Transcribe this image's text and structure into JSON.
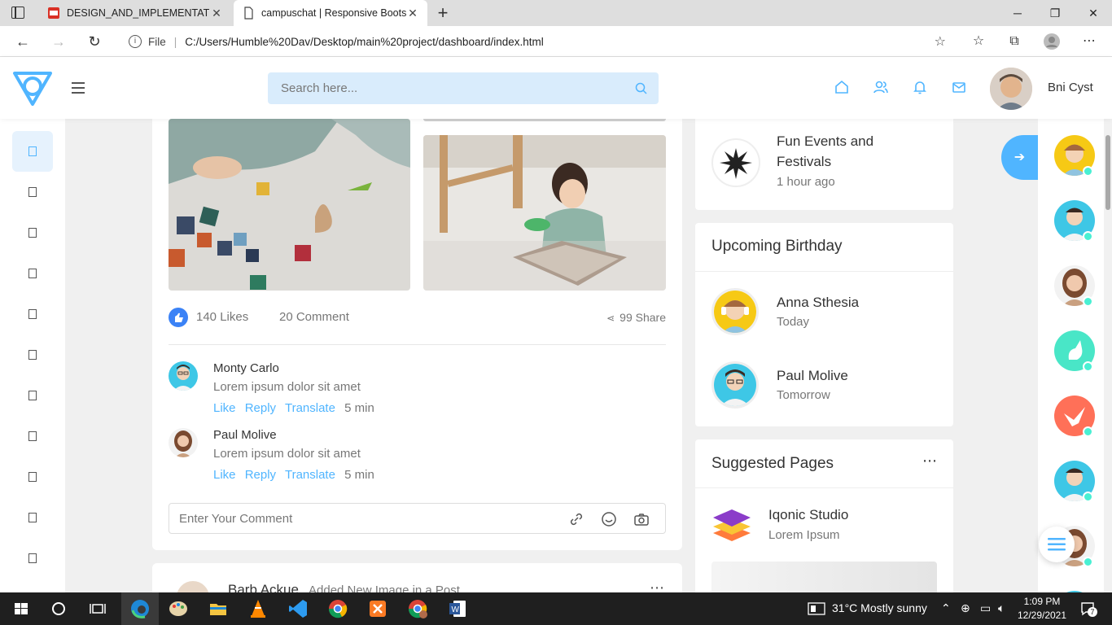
{
  "browser": {
    "tabs": [
      {
        "title": "DESIGN_AND_IMPLEMENTATION",
        "favicon": "pdf-icon",
        "active": false
      },
      {
        "title": "campuschat | Responsive Bootstr",
        "favicon": "page-icon",
        "active": true
      }
    ],
    "address": {
      "scheme_label": "File",
      "url": "C:/Users/Humble%20Dav/Desktop/main%20project/dashboard/index.html"
    }
  },
  "header": {
    "search_placeholder": "Search here...",
    "user_name": "Bni Cyst",
    "icons": [
      "home-icon",
      "friends-icon",
      "bell-icon",
      "mail-icon"
    ]
  },
  "post": {
    "likes": "140 Likes",
    "comments_count": "20 Comment",
    "shares": "99 Share",
    "comments": [
      {
        "name": "Monty Carlo",
        "text": "Lorem ipsum dolor sit amet",
        "actions": [
          "Like",
          "Reply",
          "Translate"
        ],
        "time": "5 min"
      },
      {
        "name": "Paul Molive",
        "text": "Lorem ipsum dolor sit amet",
        "actions": [
          "Like",
          "Reply",
          "Translate"
        ],
        "time": "5 min"
      }
    ],
    "comment_placeholder": "Enter Your Comment"
  },
  "next_post": {
    "author": "Barb Ackue",
    "action": "Added New Image in a Post"
  },
  "events": {
    "item_title_line1": "Fun Events and",
    "item_title_line2": "Festivals",
    "item_time": "1 hour ago"
  },
  "birthday": {
    "title": "Upcoming Birthday",
    "items": [
      {
        "name": "Anna Sthesia",
        "when": "Today"
      },
      {
        "name": "Paul Molive",
        "when": "Tomorrow"
      }
    ]
  },
  "suggested": {
    "title": "Suggested Pages",
    "items": [
      {
        "name": "Iqonic Studio",
        "sub": "Lorem Ipsum"
      }
    ]
  },
  "taskbar": {
    "weather": "31°C  Mostly sunny",
    "time": "1:09 PM",
    "date": "12/29/2021",
    "notifications": "7"
  },
  "colors": {
    "accent": "#50b5ff",
    "online": "#49f0d3",
    "like": "#3b82f6"
  }
}
